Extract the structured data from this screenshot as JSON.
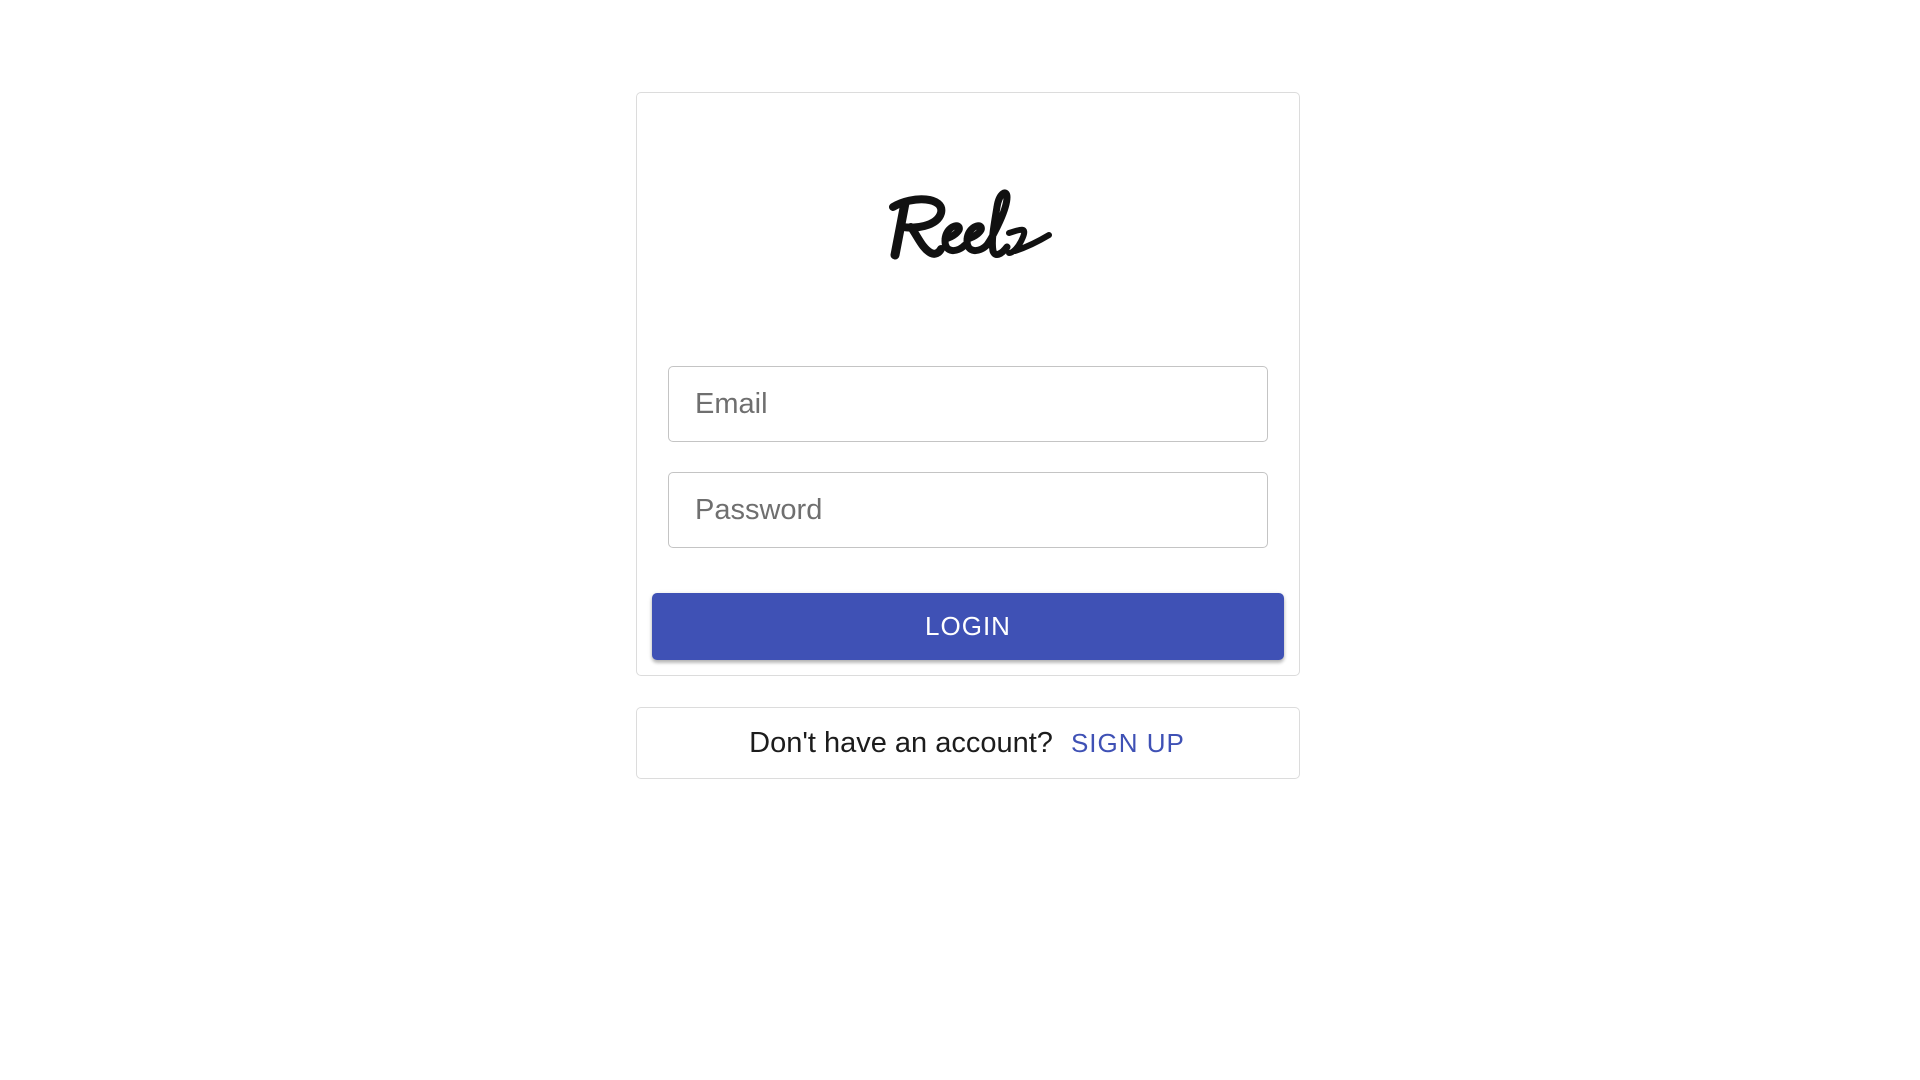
{
  "brand": {
    "logo_text": "Reels",
    "logo_icon": "reels-wordmark"
  },
  "login_form": {
    "email_placeholder": "Email",
    "email_value": "",
    "password_placeholder": "Password",
    "password_value": "",
    "login_label": "LOGIN"
  },
  "signup": {
    "prompt": "Don't have an account?",
    "link_label": "SIGN UP"
  },
  "colors": {
    "accent": "#3f51b5",
    "border": "#dcdcdc",
    "input_border": "#c4c4c4",
    "background": "#ffffff"
  }
}
